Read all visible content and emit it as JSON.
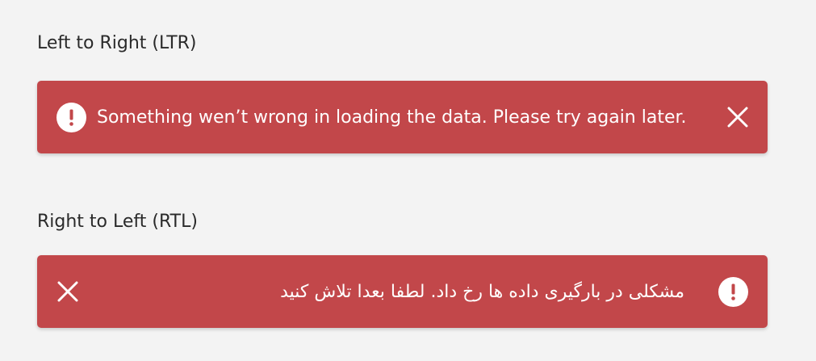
{
  "colors": {
    "background": "#f3f3f3",
    "alert_bg": "#c2474a",
    "alert_text": "#ffffff"
  },
  "ltr": {
    "title": "Left to Right (LTR)",
    "message": "Something wen’t wrong in loading the data. Please try again later.",
    "icon": "exclamation-icon",
    "close_icon": "close-icon"
  },
  "rtl": {
    "title": "Right to Left (RTL)",
    "message": "مشکلی در بارگیری داده ها رخ داد. لطفا بعدا تلاش کنید",
    "icon": "exclamation-icon",
    "close_icon": "close-icon"
  }
}
